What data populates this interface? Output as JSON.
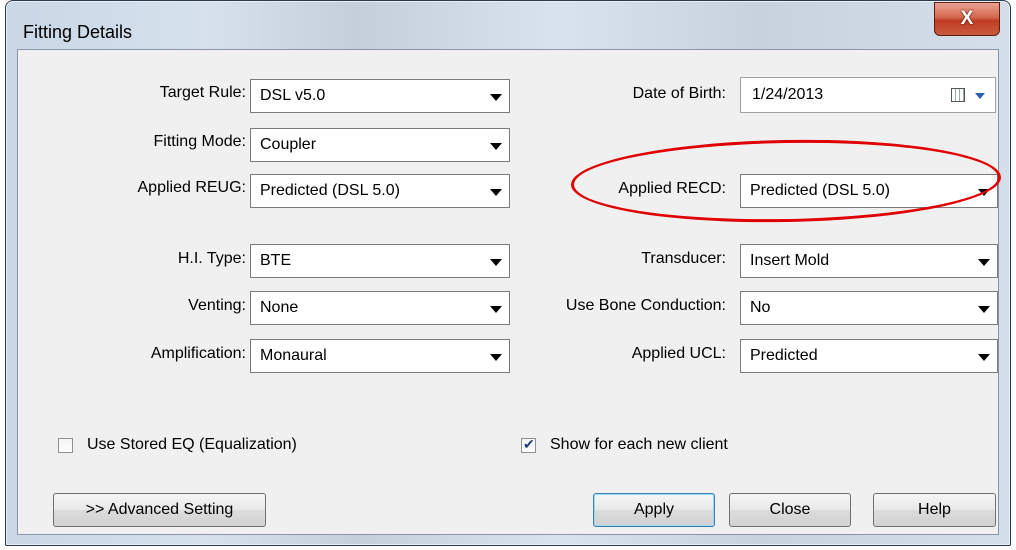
{
  "window": {
    "title": "Fitting Details",
    "close_glyph": "X"
  },
  "fields": {
    "target_rule": {
      "label": "Target Rule:",
      "value": "DSL v5.0"
    },
    "fitting_mode": {
      "label": "Fitting Mode:",
      "value": "Coupler"
    },
    "applied_reug": {
      "label": "Applied REUG:",
      "value": "Predicted (DSL 5.0)"
    },
    "hi_type": {
      "label": "H.I. Type:",
      "value": "BTE"
    },
    "venting": {
      "label": "Venting:",
      "value": "None"
    },
    "amplification": {
      "label": "Amplification:",
      "value": "Monaural"
    },
    "date_of_birth": {
      "label": "Date of Birth:",
      "value": "1/24/2013"
    },
    "applied_recd": {
      "label": "Applied RECD:",
      "value": "Predicted (DSL 5.0)"
    },
    "transducer": {
      "label": "Transducer:",
      "value": "Insert Mold"
    },
    "bone_conduction": {
      "label": "Use Bone Conduction:",
      "value": "No"
    },
    "applied_ucl": {
      "label": "Applied UCL:",
      "value": "Predicted"
    }
  },
  "checkboxes": {
    "stored_eq": {
      "label": "Use Stored EQ (Equalization)",
      "checked": false
    },
    "show_each_client": {
      "label": "Show for each new client",
      "checked": true
    }
  },
  "buttons": {
    "advanced": "&gt;&gt; Advanced Setting",
    "apply": "Apply",
    "close": "Close",
    "help": "Help"
  },
  "annotation": {
    "color": "#e00000"
  }
}
